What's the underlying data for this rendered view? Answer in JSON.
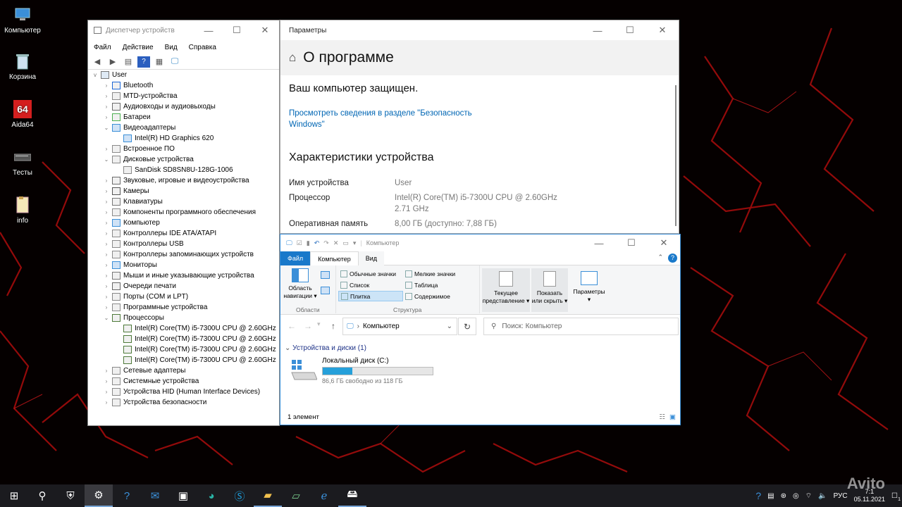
{
  "desktop": {
    "icons": [
      {
        "label": "Компьютер",
        "icon": "computer-icon"
      },
      {
        "label": "Корзина",
        "icon": "recycle-bin-icon"
      },
      {
        "label": "Aida64",
        "icon": "aida64-icon",
        "badge": "64"
      },
      {
        "label": "Тесты",
        "icon": "folder-tests-icon"
      },
      {
        "label": "info",
        "icon": "text-file-icon"
      }
    ]
  },
  "devmgr": {
    "title": "Диспетчер устройств",
    "menu": [
      "Файл",
      "Действие",
      "Вид",
      "Справка"
    ],
    "root": "User",
    "tree": [
      {
        "label": "Bluetooth",
        "level": 1,
        "exp": ">",
        "icon": "bluetooth"
      },
      {
        "label": "MTD-устройства",
        "level": 1,
        "exp": ">",
        "icon": "device"
      },
      {
        "label": "Аудиовходы и аудиовыходы",
        "level": 1,
        "exp": ">",
        "icon": "audio"
      },
      {
        "label": "Батареи",
        "level": 1,
        "exp": ">",
        "icon": "battery"
      },
      {
        "label": "Видеоадаптеры",
        "level": 1,
        "exp": "v",
        "icon": "display"
      },
      {
        "label": "Intel(R) HD Graphics 620",
        "level": 2,
        "exp": "",
        "icon": "display"
      },
      {
        "label": "Встроенное ПО",
        "level": 1,
        "exp": ">",
        "icon": "device"
      },
      {
        "label": "Дисковые устройства",
        "level": 1,
        "exp": "v",
        "icon": "disk"
      },
      {
        "label": "SanDisk SD8SN8U-128G-1006",
        "level": 2,
        "exp": "",
        "icon": "disk"
      },
      {
        "label": "Звуковые, игровые и видеоустройства",
        "level": 1,
        "exp": ">",
        "icon": "audio"
      },
      {
        "label": "Камеры",
        "level": 1,
        "exp": ">",
        "icon": "camera"
      },
      {
        "label": "Клавиатуры",
        "level": 1,
        "exp": ">",
        "icon": "keyboard"
      },
      {
        "label": "Компоненты программного обеспечения",
        "level": 1,
        "exp": ">",
        "icon": "device"
      },
      {
        "label": "Компьютер",
        "level": 1,
        "exp": ">",
        "icon": "display"
      },
      {
        "label": "Контроллеры IDE ATA/ATAPI",
        "level": 1,
        "exp": ">",
        "icon": "device"
      },
      {
        "label": "Контроллеры USB",
        "level": 1,
        "exp": ">",
        "icon": "device"
      },
      {
        "label": "Контроллеры запоминающих устройств",
        "level": 1,
        "exp": ">",
        "icon": "device"
      },
      {
        "label": "Мониторы",
        "level": 1,
        "exp": ">",
        "icon": "display"
      },
      {
        "label": "Мыши и иные указывающие устройства",
        "level": 1,
        "exp": ">",
        "icon": "mouse"
      },
      {
        "label": "Очереди печати",
        "level": 1,
        "exp": ">",
        "icon": "printer"
      },
      {
        "label": "Порты (COM и LPT)",
        "level": 1,
        "exp": ">",
        "icon": "port"
      },
      {
        "label": "Программные устройства",
        "level": 1,
        "exp": ">",
        "icon": "device"
      },
      {
        "label": "Процессоры",
        "level": 1,
        "exp": "v",
        "icon": "cpu"
      },
      {
        "label": "Intel(R) Core(TM) i5-7300U CPU @ 2.60GHz",
        "level": 2,
        "exp": "",
        "icon": "cpu"
      },
      {
        "label": "Intel(R) Core(TM) i5-7300U CPU @ 2.60GHz",
        "level": 2,
        "exp": "",
        "icon": "cpu"
      },
      {
        "label": "Intel(R) Core(TM) i5-7300U CPU @ 2.60GHz",
        "level": 2,
        "exp": "",
        "icon": "cpu"
      },
      {
        "label": "Intel(R) Core(TM) i5-7300U CPU @ 2.60GHz",
        "level": 2,
        "exp": "",
        "icon": "cpu"
      },
      {
        "label": "Сетевые адаптеры",
        "level": 1,
        "exp": ">",
        "icon": "device"
      },
      {
        "label": "Системные устройства",
        "level": 1,
        "exp": ">",
        "icon": "device"
      },
      {
        "label": "Устройства HID (Human Interface Devices)",
        "level": 1,
        "exp": ">",
        "icon": "device"
      },
      {
        "label": "Устройства безопасности",
        "level": 1,
        "exp": ">",
        "icon": "device"
      }
    ]
  },
  "settings": {
    "title": "Параметры",
    "heading": "О программе",
    "protected": "Ваш компьютер защищен.",
    "link_line1": "Просмотреть сведения в разделе \"Безопасность",
    "link_line2": "Windows\"",
    "specs_heading": "Характеристики устройства",
    "specs": [
      {
        "k": "Имя устройства",
        "v": "User",
        "v2": ""
      },
      {
        "k": "Процессор",
        "v": "Intel(R) Core(TM) i5-7300U CPU @ 2.60GHz",
        "v2": "2.71 GHz"
      },
      {
        "k": "Оперативная память",
        "v": "8,00 ГБ (доступно: 7,88 ГБ)",
        "v2": ""
      }
    ]
  },
  "explorer": {
    "title": "Компьютер",
    "tabs": [
      "Файл",
      "Компьютер",
      "Вид"
    ],
    "ribbon": {
      "nav_area": "Область навигации",
      "nav_line1": "Область",
      "nav_line2": "навигации",
      "group_areas": "Области",
      "layout": [
        "Обычные значки",
        "Мелкие значки",
        "Список",
        "Таблица",
        "Плитка",
        "Содержимое"
      ],
      "group_structure": "Структура",
      "current_view_1": "Текущее",
      "current_view_2": "представление",
      "showhide_1": "Показать",
      "showhide_2": "или скрыть",
      "params": "Параметры"
    },
    "address": "Компьютер",
    "search_placeholder": "Поиск: Компьютер",
    "section": "Устройства и диски (1)",
    "drive": {
      "name": "Локальный диск (C:)",
      "free": "86,6 ГБ свободно из 118 ГБ",
      "used_fraction": 0.27
    },
    "status": "1 элемент"
  },
  "taskbar": {
    "lang": "РУС",
    "time": "7:1",
    "date": "05.11.2021",
    "notif_count": "1",
    "watermark": "Avito"
  },
  "colors": {
    "accent": "#0078d7",
    "link": "#0066b4",
    "taskbar": "#1b1b1f"
  }
}
